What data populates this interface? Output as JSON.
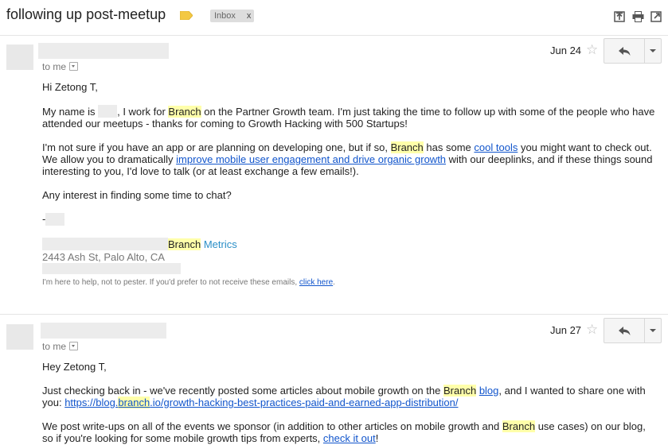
{
  "thread": {
    "subject": "following up post-meetup",
    "label": "Inbox",
    "label_remove": "x"
  },
  "toolbar_icons": [
    "expand-all-icon",
    "print-icon",
    "new-window-icon"
  ],
  "message1": {
    "to_me": "to me",
    "date": "Jun 24",
    "greeting": "Hi Zetong T,",
    "p1_a": "My name is",
    "p1_b": ", I work for",
    "p1_branch": "Branch",
    "p1_c": "on the Partner Growth team. I'm just taking the time to follow up with some of the people who have attended our meetups - thanks for coming to Growth Hacking with 500 Startups!",
    "p2_a": "I'm not sure if you have an app or are planning on developing one, but if so,",
    "p2_branch": "Branch",
    "p2_b": "has some",
    "p2_link1": "cool tools",
    "p2_c": "you might want to check out. We allow you to dramatically",
    "p2_link2": "improve mobile user engagement and drive organic growth",
    "p2_d": "with our deeplinks, and if these things sound interesting to you, I'd love to talk (or at least exchange a few emails!).",
    "p3": "Any interest in finding some time to chat?",
    "dash": "-",
    "sig_branch": "Branch",
    "sig_metrics": "Metrics",
    "address": "2443 Ash St, Palo Alto, CA",
    "footer_text": "I'm here to help, not to pester. If you'd prefer to not receive these emails,",
    "footer_link": "click here",
    "footer_end": "."
  },
  "message2": {
    "to_me": "to me",
    "date": "Jun 27",
    "greeting": "Hey Zetong T,",
    "p1_a": "Just checking back in - we've recently posted some articles about mobile growth on the",
    "p1_branch_link": "Branch",
    "p1_blog_link": "blog",
    "p1_b": ", and I wanted to share one with you:",
    "p1_url_a": "https://blog.",
    "p1_url_branch": "branch",
    "p1_url_b": ".io/growth-hacking-best-practices-paid-and-earned-app-distribution/",
    "p2_a": "We post write-ups on all of the events we sponsor (in addition to other articles on mobile growth and",
    "p2_branch": "Branch",
    "p2_b": "use cases) on our blog, so if you're looking for some mobile growth tips from experts,",
    "p2_link": "check it out",
    "p2_c": "!"
  },
  "colors": {
    "highlight": "#ffffaa",
    "link": "#1155cc",
    "metrics_link": "#2b8fc7"
  }
}
